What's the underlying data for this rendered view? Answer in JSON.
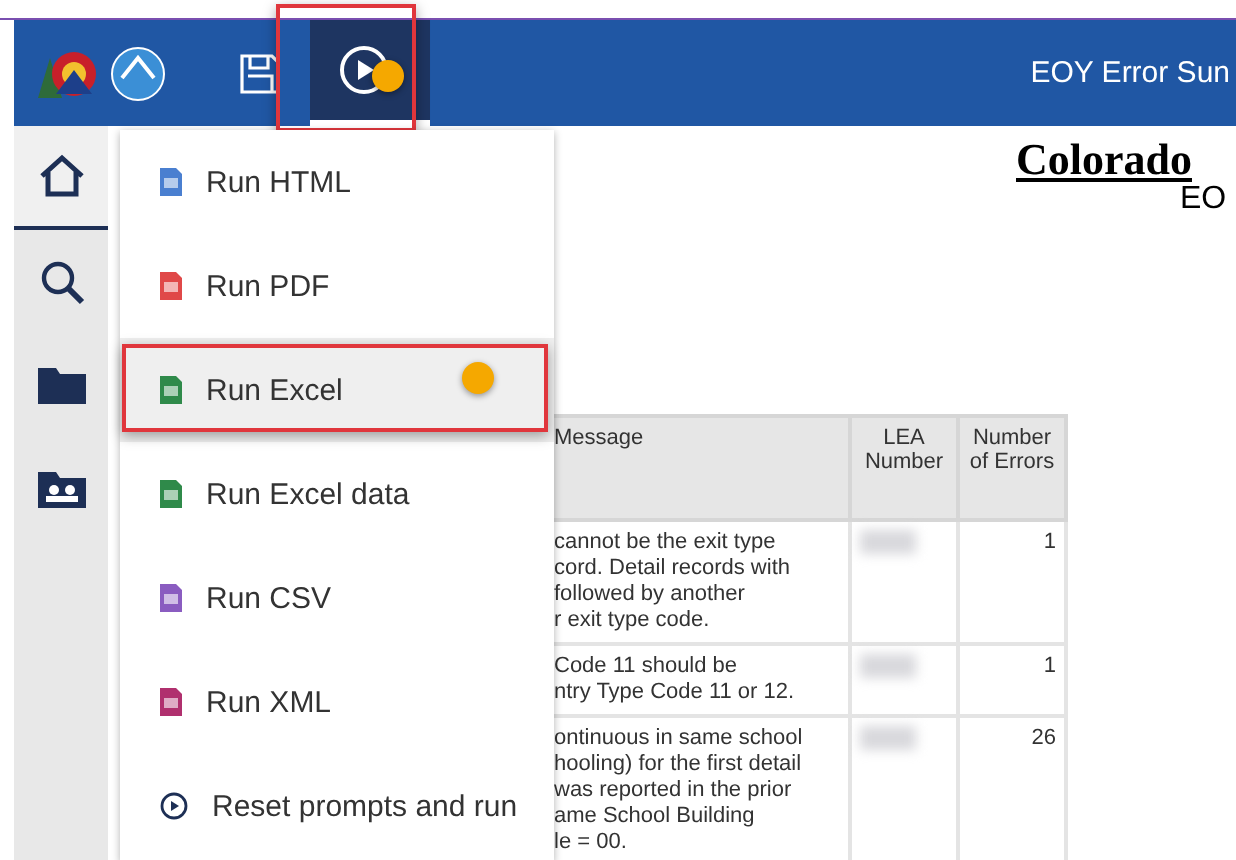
{
  "toolbar": {
    "report_title": "EOY Error Sun",
    "run_button": {
      "selected": true
    }
  },
  "sidebar": {
    "items": [
      {
        "kind": "home",
        "selected": true
      },
      {
        "kind": "search",
        "selected": false
      },
      {
        "kind": "folder",
        "selected": false
      },
      {
        "kind": "team",
        "selected": false
      }
    ]
  },
  "run_menu": {
    "items": [
      {
        "kind": "html",
        "label": "Run HTML",
        "selected": false
      },
      {
        "kind": "pdf",
        "label": "Run PDF",
        "selected": false
      },
      {
        "kind": "excel",
        "label": "Run Excel",
        "selected": true
      },
      {
        "kind": "excel",
        "label": "Run Excel data",
        "selected": false
      },
      {
        "kind": "csv",
        "label": "Run CSV",
        "selected": false
      },
      {
        "kind": "xml",
        "label": "Run XML",
        "selected": false
      },
      {
        "kind": "play",
        "label": "Reset prompts and run",
        "selected": false
      }
    ]
  },
  "report": {
    "heading": "Colorado",
    "subheading": "EO",
    "table": {
      "columns": [
        "Message",
        "LEA Number",
        "Number of Errors"
      ],
      "rows": [
        {
          "message_lines": [
            "cannot be the exit type",
            "cord. Detail records with",
            "followed by another",
            "r exit type code."
          ],
          "errors": "1"
        },
        {
          "message_lines": [
            "Code 11 should be",
            "ntry Type Code 11 or 12."
          ],
          "errors": "1"
        },
        {
          "message_lines": [
            "ontinuous in same school",
            "hooling) for the first detail",
            "was reported in the prior",
            "ame School Building",
            "le = 00."
          ],
          "errors": "26"
        }
      ]
    }
  }
}
